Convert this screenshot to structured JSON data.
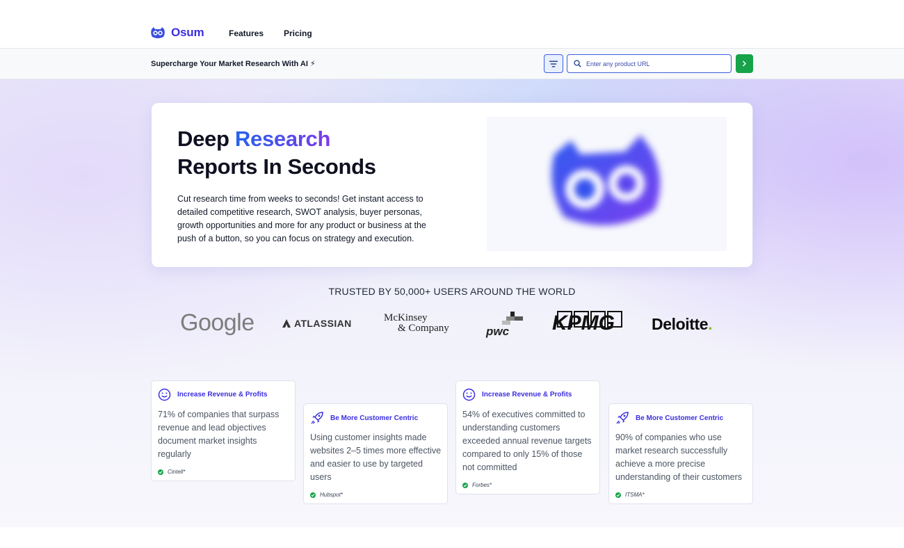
{
  "nav": {
    "brand": "Osum",
    "links": [
      "Features",
      "Pricing"
    ]
  },
  "searchbar": {
    "tagline": "Supercharge Your Market Research With AI ⚡",
    "url_placeholder": "Enter any product URL"
  },
  "hero": {
    "title_line1_a": "Deep ",
    "title_line1_b": "Research",
    "title_line2": "Reports In Seconds",
    "description": "Cut research time from weeks to seconds! Get instant access to detailed competitive research, SWOT analysis, buyer personas, growth opportunities and more for any product or business at the push of a button, so you can focus on strategy and execution."
  },
  "trusted": {
    "heading": "TRUSTED BY 50,000+ USERS AROUND THE WORLD",
    "logos": {
      "google": "Google",
      "atlassian": "ATLASSIAN",
      "mckinsey_1": "McKinsey",
      "mckinsey_2": "& Company",
      "pwc": "pwc",
      "kpmg": "KPMG",
      "deloitte": "Deloitte",
      "deloitte_dot": "."
    }
  },
  "stats": [
    {
      "icon": "smile-icon",
      "title": "Increase Revenue & Profits",
      "body": "71% of companies that surpass revenue and lead objectives document market insights regularly",
      "source": "Cintell*"
    },
    {
      "icon": "rocket-icon",
      "title": "Be More Customer Centric",
      "body": "Using customer insights made websites 2–5 times more effective and easier to use by targeted users",
      "source": "Hubspot*"
    },
    {
      "icon": "smile-icon",
      "title": "Increase Revenue & Profits",
      "body": "54% of executives committed to understanding customers exceeded annual revenue targets compared to only 15% of those not committed",
      "source": "Forbes*"
    },
    {
      "icon": "rocket-icon",
      "title": "Be More Customer Centric",
      "body": "90% of companies who use market research successfully achieve a more precise understanding of their customers",
      "source": "ITSMA*"
    }
  ],
  "colors": {
    "brand": "#3b2fe0",
    "accent_blue": "#2563eb",
    "accent_purple": "#7c3aed",
    "go_green": "#16a34a"
  }
}
